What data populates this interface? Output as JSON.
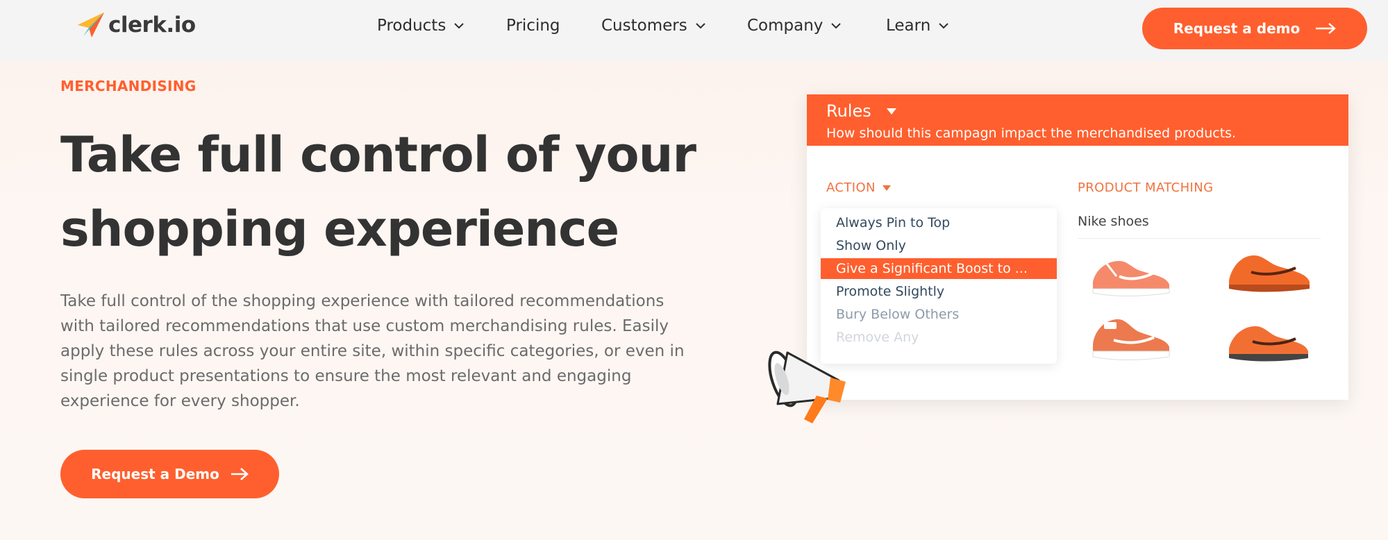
{
  "nav": {
    "logo_text": "clerk.io",
    "items": [
      {
        "label": "Products",
        "dropdown": true
      },
      {
        "label": "Pricing",
        "dropdown": false
      },
      {
        "label": "Customers",
        "dropdown": true
      },
      {
        "label": "Company",
        "dropdown": true
      },
      {
        "label": "Learn",
        "dropdown": true
      }
    ],
    "cta_label": "Request a demo"
  },
  "hero": {
    "eyebrow": "MERCHANDISING",
    "headline_line1": "Take full control of your",
    "headline_line2": "shopping experience",
    "body": "Take full control of the shopping experience with tailored recommendations with tailored recommendations that use custom merchandising rules. Easily apply these rules across your entire site, within specific categories, or even in single product presentations to ensure the most relevant and engaging experience for every shopper.",
    "cta_label": "Request a Demo"
  },
  "rules_card": {
    "title": "Rules",
    "subtitle": "How should this campagn impact the merchandised products.",
    "action_label": "ACTION",
    "product_matching_label": "PRODUCT MATCHING",
    "actions": [
      {
        "label": "Always Pin to Top",
        "state": "normal"
      },
      {
        "label": "Show Only",
        "state": "normal"
      },
      {
        "label": "Give a Significant Boost to ...",
        "state": "selected"
      },
      {
        "label": "Promote Slightly",
        "state": "normal"
      },
      {
        "label": "Bury Below Others",
        "state": "faded"
      },
      {
        "label": "Remove Any",
        "state": "faint"
      }
    ],
    "search_value": "Nike shoes"
  },
  "colors": {
    "accent": "#ff5f2e",
    "text_dark": "#333333",
    "text_body": "#6b6b6b",
    "nav_bg": "#f4f4f4",
    "page_bg": "#fdf3ee"
  },
  "icons": {
    "logo": "paper-plane-logo-icon",
    "nav_chevron": "chevron-down-icon",
    "cta_arrow": "arrow-right-icon",
    "dropdown_caret": "caret-down-icon",
    "megaphone": "megaphone-icon"
  }
}
